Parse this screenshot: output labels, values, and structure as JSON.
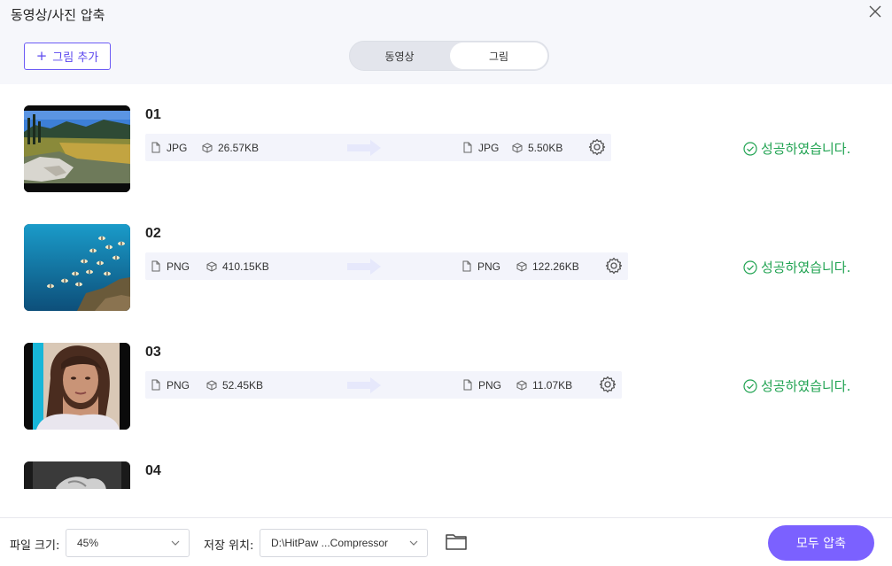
{
  "window": {
    "title": "동영상/사진 압축"
  },
  "toolbar": {
    "add_label": "그림 추가"
  },
  "tabs": [
    {
      "label": "동영상",
      "active": false
    },
    {
      "label": "그림",
      "active": true
    }
  ],
  "files": [
    {
      "num": "01",
      "src_format": "JPG",
      "src_size": "26.57KB",
      "dst_format": "JPG",
      "dst_size": "5.50KB",
      "status": "성공하였습니다."
    },
    {
      "num": "02",
      "src_format": "PNG",
      "src_size": "410.15KB",
      "dst_format": "PNG",
      "dst_size": "122.26KB",
      "status": "성공하였습니다."
    },
    {
      "num": "03",
      "src_format": "PNG",
      "src_size": "52.45KB",
      "dst_format": "PNG",
      "dst_size": "11.07KB",
      "status": "성공하였습니다."
    },
    {
      "num": "04"
    }
  ],
  "footer": {
    "file_size_label": "파일 크기:",
    "file_size_value": "45%",
    "save_location_label": "저장 위치:",
    "save_location_value": "D:\\HitPaw ...Compressor",
    "compress_all_label": "모두 압축"
  },
  "colors": {
    "accent": "#7b61ff",
    "success": "#21a352",
    "header_bg": "#f6f7fb"
  }
}
